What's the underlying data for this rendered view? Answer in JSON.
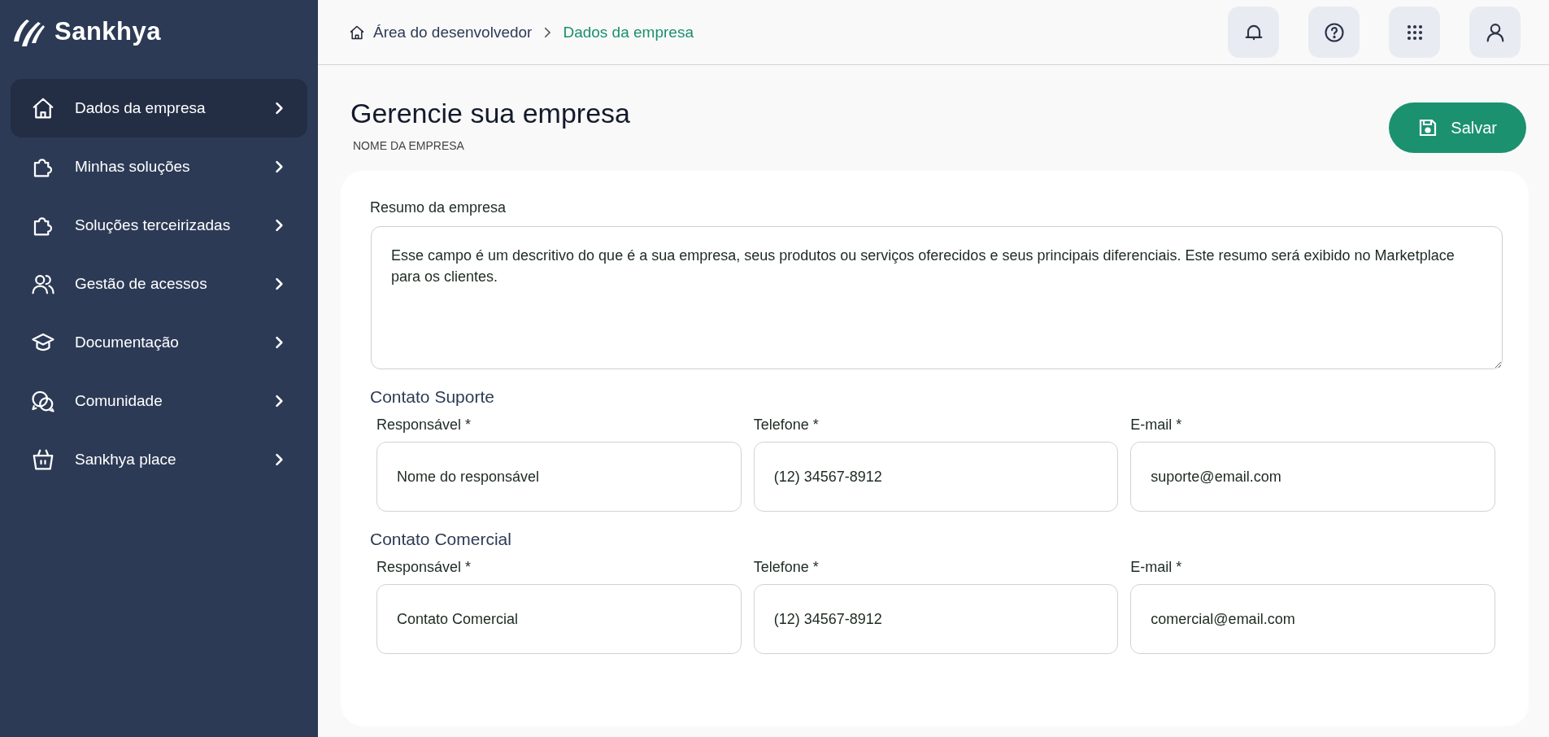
{
  "sidebar": {
    "logo": "Sankhya",
    "items": [
      {
        "label": "Dados da empresa",
        "selected": true
      },
      {
        "label": "Minhas soluções",
        "selected": false
      },
      {
        "label": "Soluções terceirizadas",
        "selected": false
      },
      {
        "label": "Gestão de acessos",
        "selected": false
      },
      {
        "label": "Documentação",
        "selected": false
      },
      {
        "label": "Comunidade",
        "selected": false
      },
      {
        "label": "Sankhya place",
        "selected": false
      }
    ]
  },
  "breadcrumb": [
    "Área do desenvolvedor",
    "Dados da empresa"
  ],
  "page": {
    "title": "Gerencie sua empresa",
    "subtitle": "NOME DA EMPRESA",
    "save_button": "Salvar"
  },
  "form": {
    "summary": {
      "label": "Resumo da empresa",
      "value": "Esse campo é um descritivo do que é a sua empresa, seus produtos ou serviços oferecidos e seus principais diferenciais. Este resumo será exibido no Marketplace para os clientes."
    },
    "sections": [
      {
        "title": "Contato Suporte",
        "fields": [
          {
            "label": "Responsável *",
            "value": "Nome do responsável"
          },
          {
            "label": "Telefone *",
            "value": "(12) 34567-8912"
          },
          {
            "label": "E-mail *",
            "value": "suporte@email.com"
          }
        ]
      },
      {
        "title": "Contato Comercial",
        "fields": [
          {
            "label": "Responsável *",
            "value": "Contato Comercial"
          },
          {
            "label": "Telefone *",
            "value": "(12) 34567-8912"
          },
          {
            "label": "E-mail *",
            "value": "comercial@email.com"
          }
        ]
      }
    ]
  }
}
